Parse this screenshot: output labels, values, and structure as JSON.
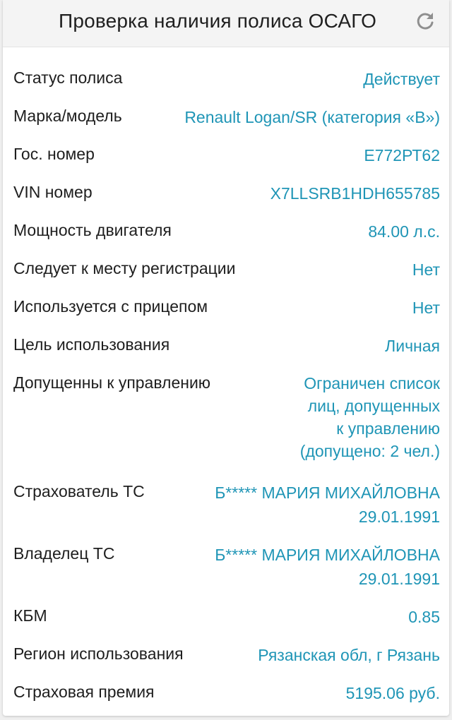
{
  "header": {
    "title": "Проверка наличия полиса ОСАГО",
    "refresh_icon": "refresh-icon"
  },
  "colors": {
    "label": "#1e1e1e",
    "value": "#1f95b6",
    "header_bg": "#f4f4f4"
  },
  "rows": [
    {
      "label": "Статус полиса",
      "value": "Действует"
    },
    {
      "label": "Марка/модель",
      "value": "Renault Logan/SR (категория «В»)"
    },
    {
      "label": "Гос. номер",
      "value": "Е772РТ62"
    },
    {
      "label": "VIN номер",
      "value": "X7LLSRB1HDH655785"
    },
    {
      "label": "Мощность двигателя",
      "value": "84.00 л.с."
    },
    {
      "label": "Следует к месту регистрации",
      "value": "Нет"
    },
    {
      "label": "Используется с прицепом",
      "value": "Нет"
    },
    {
      "label": "Цель использования",
      "value": "Личная"
    },
    {
      "label": "Допущенны к управлению",
      "value": "Ограничен список\nлиц, допущенных\nк управлению\n(допущено: 2 чел.)"
    },
    {
      "label": "Страхователь ТС",
      "value": "Б***** МАРИЯ МИХАЙЛОВНА\n29.01.1991"
    },
    {
      "label": "Владелец ТС",
      "value": "Б***** МАРИЯ МИХАЙЛОВНА\n29.01.1991"
    },
    {
      "label": "КБМ",
      "value": "0.85"
    },
    {
      "label": "Регион использования",
      "value": "Рязанская обл, г Рязань"
    },
    {
      "label": "Страховая премия",
      "value": "5195.06 руб."
    }
  ]
}
